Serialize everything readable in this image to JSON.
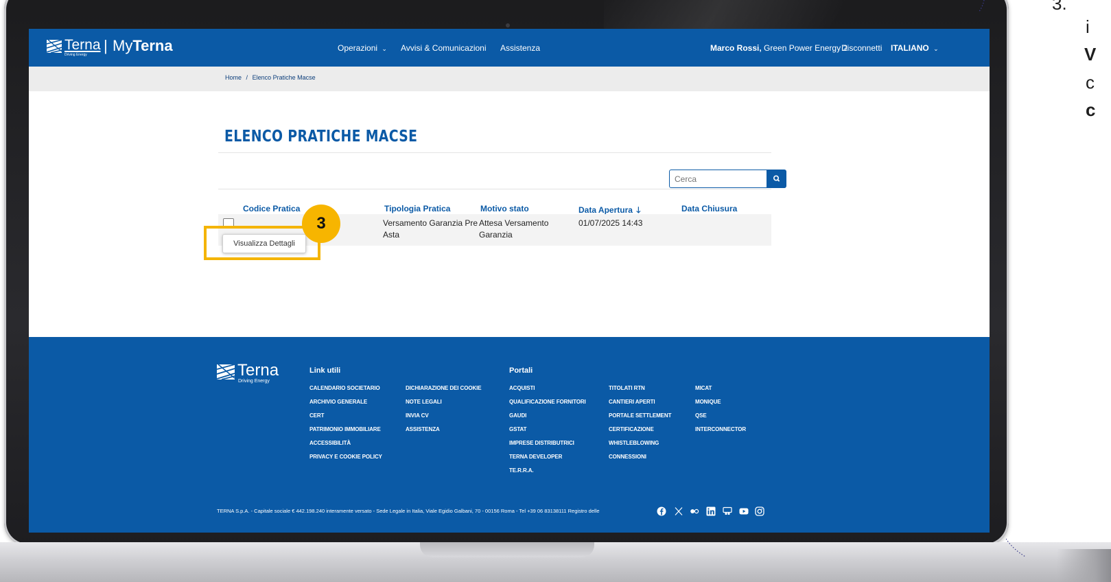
{
  "header": {
    "logo_text": "Terna",
    "logo_sub": "Driving Energy",
    "divider": "|",
    "app_name_prefix": "My",
    "app_name_bold": "Terna",
    "nav": [
      {
        "label": "Operazioni"
      },
      {
        "label": "Avvisi & Comunicazioni"
      },
      {
        "label": "Assistenza"
      }
    ],
    "user_name": "Marco Rossi,",
    "company": " Green Power Energy 2",
    "logout": "Disconnetti",
    "language": "ITALIANO"
  },
  "breadcrumb": {
    "home": "Home",
    "separator": "/",
    "current": "Elenco Pratiche Macse"
  },
  "page": {
    "title": "ELENCO PRATICHE MACSE"
  },
  "search": {
    "placeholder": "Cerca"
  },
  "table": {
    "columns": [
      "Codice Pratica",
      "Tipologia Pratica",
      "Motivo stato",
      "Data Apertura",
      "Data Chiusura"
    ],
    "sort_column": "Data Apertura",
    "rows": [
      {
        "codice": "",
        "tipologia": [
          "Versamento Garanzia Pre",
          "Asta"
        ],
        "motivo": [
          "Attesa Versamento",
          "Garanzia"
        ],
        "apertura": "01/07/2025 14:43",
        "chiusura": ""
      }
    ]
  },
  "row_menu": {
    "details": "Visualizza Dettagli"
  },
  "callout": {
    "step": "3",
    "color": "#f7b500"
  },
  "footer": {
    "logo_text": "Terna",
    "logo_sub": "Driving Energy",
    "link_utili_title": "Link utili",
    "portali_title": "Portali",
    "link_utili_col1": [
      "CALENDARIO SOCIETARIO",
      "ARCHIVIO GENERALE",
      "CERT",
      "PATRIMONIO IMMOBILIARE",
      "ACCESSIBILITÀ",
      "PRIVACY E COOKIE POLICY"
    ],
    "link_utili_col2": [
      "DICHIARAZIONE DEI COOKIE",
      "NOTE LEGALI",
      "INVIA CV",
      "ASSISTENZA"
    ],
    "portali_col1": [
      "ACQUISTI",
      "QUALIFICAZIONE FORNITORI",
      "GAUDI",
      "GSTAT",
      "IMPRESE DISTRIBUTRICI",
      "TERNA DEVELOPER",
      "TE.R.R.A."
    ],
    "portali_col2": [
      "TITOLATI RTN",
      "CANTIERI APERTI",
      "PORTALE SETTLEMENT",
      "CERTIFICAZIONE",
      "WHISTLEBLOWING",
      "CONNESSIONI"
    ],
    "portali_col3": [
      "MICAT",
      "MONIQUE",
      "QSE",
      "INTERCONNECTOR"
    ],
    "legal": "TERNA S.p.A. - Capitale sociale € 442.198.240 interamente versato - Sede Legale in Italia, Viale Egidio Galbani, 70 - 00156 Roma - Tel +39 06 83138111 Registro delle",
    "social_icons": [
      "facebook-icon",
      "x-icon",
      "flickr-icon",
      "linkedin-icon",
      "slideshare-icon",
      "youtube-icon",
      "instagram-icon"
    ]
  },
  "side_text": {
    "line1": "3.",
    "line2": "i",
    "line3": "V",
    "line4": "c",
    "line5": "c"
  },
  "colors": {
    "brand_blue": "#0b5aa6",
    "highlight": "#f4b400"
  }
}
